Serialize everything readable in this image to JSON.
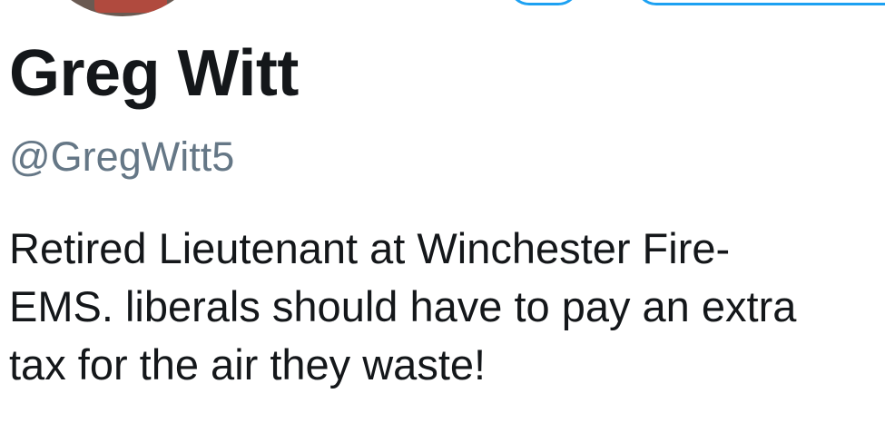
{
  "profile": {
    "display_name": "Greg Witt",
    "handle": "@GregWitt5",
    "bio_lines": [
      "Retired Lieutenant at Winchester Fire-",
      "EMS. liberals should have to pay an extra",
      "tax for the air they waste!"
    ]
  },
  "colors": {
    "accent": "#1da1f2",
    "text_primary": "#14171a",
    "text_secondary": "#657786"
  }
}
